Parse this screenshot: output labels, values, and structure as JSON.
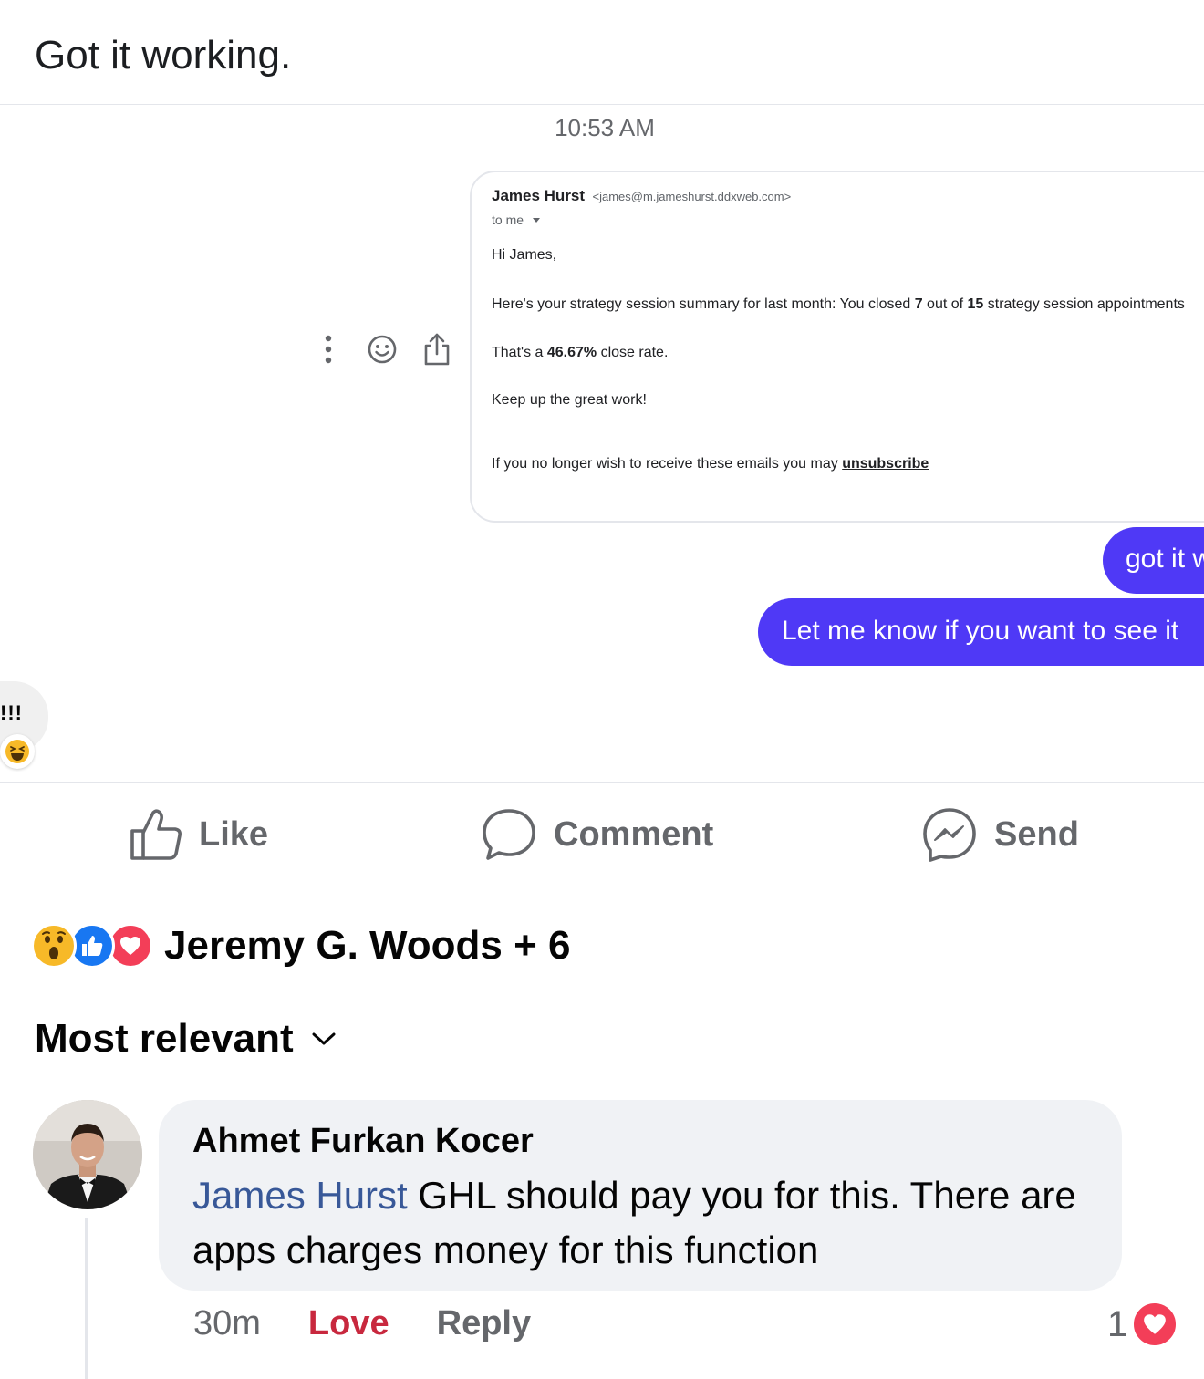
{
  "post": {
    "text": "Got it working."
  },
  "screenshot": {
    "timestamp": "10:53 AM",
    "email": {
      "sender_name": "James Hurst",
      "sender_email": "<james@m.jameshurst.ddxweb.com>",
      "to": "to me",
      "greeting": "Hi James,",
      "summary_prefix": "Here's your strategy session summary for last month: You closed ",
      "closed_count": "7",
      "summary_mid": " out of ",
      "total_count": "15",
      "summary_suffix": " strategy session appointments",
      "rate_prefix": "That's a ",
      "rate_value": "46.67%",
      "rate_suffix": " close rate.",
      "closing": "Keep up the great work!",
      "unsub_prefix": "If you no longer wish to receive these emails you may ",
      "unsub_link": "unsubscribe"
    },
    "messages": [
      {
        "text": "got it working"
      },
      {
        "text": "Let me know if you want to see it"
      }
    ],
    "left_message": {
      "text": "!!!"
    }
  },
  "actions": {
    "like": "Like",
    "comment": "Comment",
    "send": "Send"
  },
  "reactions": {
    "icons": [
      "wow-icon",
      "like-icon",
      "love-icon"
    ],
    "names": "Jeremy G. Woods + 6"
  },
  "sort": {
    "label": "Most relevant"
  },
  "comment": {
    "author": "Ahmet Furkan Kocer",
    "mention": "James Hurst",
    "text": " GHL should pay you for this. There are apps charges money for this function",
    "time": "30m",
    "love_label": "Love",
    "reply_label": "Reply",
    "reaction_count": "1"
  },
  "colors": {
    "messenger_bubble": "#4f39f6",
    "mention": "#385898",
    "love_red": "#f33e58",
    "like_blue": "#1877f2"
  }
}
